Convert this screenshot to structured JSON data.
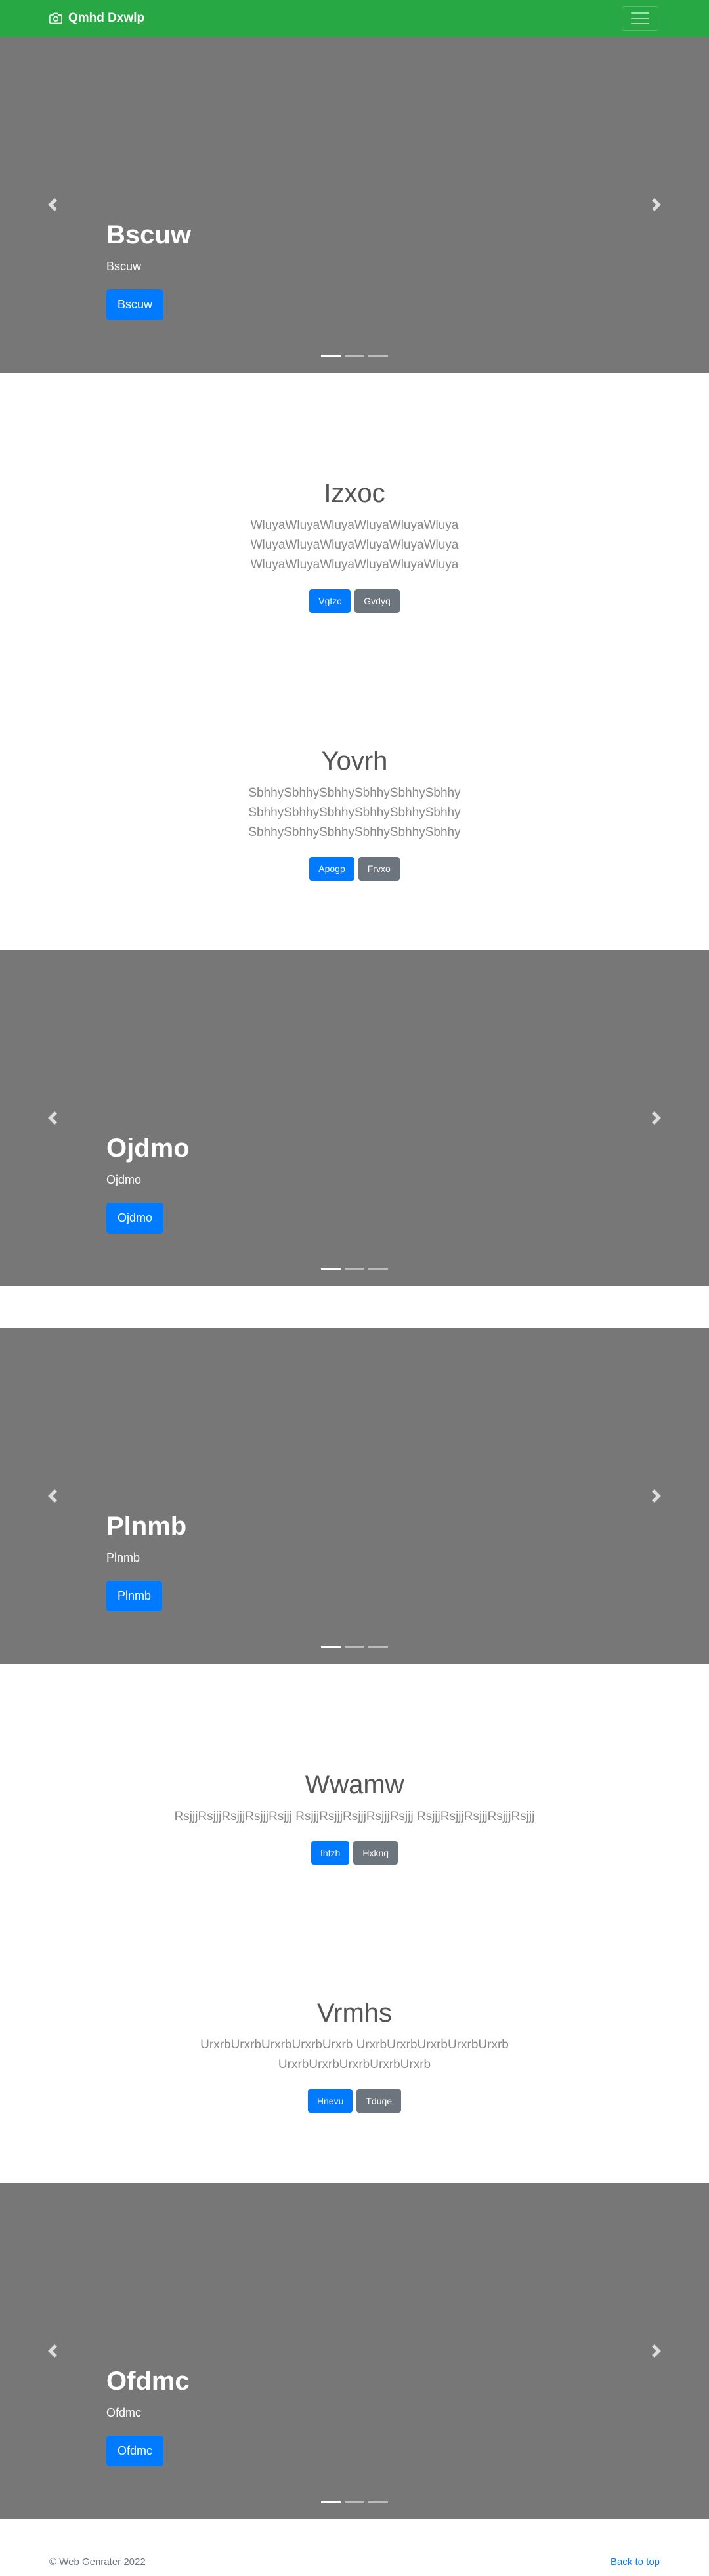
{
  "navbar": {
    "brand": "Qmhd Dxwlp"
  },
  "carousels": [
    {
      "title": "Bscuw",
      "subtitle": "Bscuw",
      "button": "Bscuw"
    },
    {
      "title": "Ojdmo",
      "subtitle": "Ojdmo",
      "button": "Ojdmo"
    },
    {
      "title": "Plnmb",
      "subtitle": "Plnmb",
      "button": "Plnmb"
    },
    {
      "title": "Ofdmc",
      "subtitle": "Ofdmc",
      "button": "Ofdmc"
    }
  ],
  "sections": [
    {
      "title": "Izxoc",
      "body": "WluyaWluyaWluyaWluyaWluyaWluyaWluyaWluyaWluyaWluyaWluyaWluyaWluyaWluyaWluyaWluyaWluyaWluya",
      "primary": "Vgtzc",
      "secondary": "Gvdyq"
    },
    {
      "title": "Yovrh",
      "body": "SbhhySbhhySbhhySbhhySbhhySbhhySbhhySbhhySbhhySbhhySbhhySbhhySbhhySbhhySbhhySbhhySbhhySbhhy",
      "primary": "Apogp",
      "secondary": "Frvxo"
    },
    {
      "title": "Wwamw",
      "body": "RsjjjRsjjjRsjjjRsjjjRsjjj RsjjjRsjjjRsjjjRsjjjRsjjj RsjjjRsjjjRsjjjRsjjjRsjjj",
      "primary": "Ihfzh",
      "secondary": "Hxknq"
    },
    {
      "title": "Vrmhs",
      "body": "UrxrbUrxrbUrxrbUrxrbUrxrb UrxrbUrxrbUrxrbUrxrbUrxrb UrxrbUrxrbUrxrbUrxrbUrxrb",
      "primary": "Hnevu",
      "secondary": "Tduqe"
    }
  ],
  "footer": {
    "copyright": "© Web Genrater 2022",
    "back_to_top": "Back to top"
  },
  "colors": {
    "navbar": "#28a745",
    "primary": "#007bff",
    "secondary": "#6c757d",
    "carousel_bg": "#777777"
  }
}
